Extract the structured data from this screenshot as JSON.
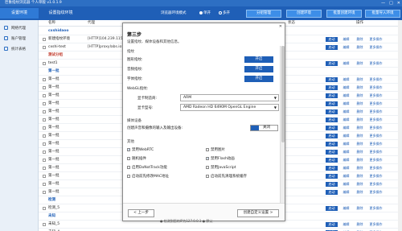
{
  "window": {
    "title": "巨象指纹浏览器 个人单版 v1.0.1.9",
    "controls": [
      "—",
      "□",
      "✕"
    ]
  },
  "topbar": {
    "tab_env": "设置环境",
    "tab_browser": "设置指纹环境",
    "mode_label": "浏览器环境模式",
    "radio_single": "单开",
    "radio_multi": "多开",
    "buttons": [
      "分组管理",
      "创建环境",
      "批量创建环境",
      "批量导入环境"
    ]
  },
  "sidebar": {
    "items": [
      {
        "label": "网络代理",
        "icon": "globe-icon"
      },
      {
        "label": "账户管理",
        "icon": "user-icon"
      },
      {
        "label": "统计表格",
        "icon": "chart-icon"
      }
    ]
  },
  "list": {
    "headers": {
      "name": "名称",
      "proxy": "代理",
      "status": "状态",
      "actions": "操作"
    },
    "rows": [
      {
        "type": "group",
        "name": "cxshidaoo",
        "red": false
      },
      {
        "type": "item",
        "name": "新建指纹环境",
        "proxy": "[HTTP]104.239.115..."
      },
      {
        "type": "item",
        "name": "cxshi-test",
        "proxy": "[HTTP]proxylabs.io:..."
      },
      {
        "type": "group",
        "name": "测试分组",
        "red": true
      },
      {
        "type": "item",
        "name": "test1",
        "proxy": ""
      },
      {
        "type": "group",
        "name": "第一批",
        "red": false
      },
      {
        "type": "item",
        "name": "第一批",
        "proxy": ""
      },
      {
        "type": "item",
        "name": "第一批",
        "proxy": ""
      },
      {
        "type": "item",
        "name": "第一批",
        "proxy": ""
      },
      {
        "type": "item",
        "name": "第一批",
        "proxy": ""
      },
      {
        "type": "item",
        "name": "第一批",
        "proxy": ""
      },
      {
        "type": "item",
        "name": "第一批",
        "proxy": ""
      },
      {
        "type": "item",
        "name": "第一批",
        "proxy": ""
      },
      {
        "type": "item",
        "name": "第一批",
        "proxy": ""
      },
      {
        "type": "item",
        "name": "第一批",
        "proxy": ""
      },
      {
        "type": "item",
        "name": "第一批",
        "proxy": ""
      },
      {
        "type": "item",
        "name": "第一批",
        "proxy": ""
      },
      {
        "type": "item",
        "name": "第一批",
        "proxy": ""
      },
      {
        "type": "item",
        "name": "第一批",
        "proxy": ""
      },
      {
        "type": "item",
        "name": "第一批",
        "proxy": ""
      },
      {
        "type": "item",
        "name": "第一批",
        "proxy": ""
      },
      {
        "type": "group",
        "name": "检测",
        "red": false
      },
      {
        "type": "item",
        "name": "检测_5",
        "proxy": ""
      },
      {
        "type": "group",
        "name": "未知",
        "red": false
      },
      {
        "type": "item",
        "name": "未知_5",
        "proxy": ""
      },
      {
        "type": "item",
        "name": "未知_4",
        "proxy": ""
      }
    ],
    "actions": {
      "start": "启动",
      "edit": "编辑",
      "delete": "删除",
      "more": "更多操作"
    }
  },
  "dialog": {
    "close": "✕",
    "title": "第三步",
    "desc": "设置指纹、媒体设备和其他信息。",
    "fingerprint_section": "指纹",
    "fingerprint_items": [
      {
        "label": "图形指纹:",
        "value": "开启"
      },
      {
        "label": "音频指纹:",
        "value": "开启"
      },
      {
        "label": "字体指纹:",
        "value": "开启"
      }
    ],
    "webgl_label": "WebGL指纹:",
    "gpu_vendor_label": "显卡制造商:",
    "gpu_vendor_value": "ARM",
    "gpu_model_label": "显卡型号:",
    "gpu_model_value": "AMD Radeon HD 6490M OpenGL Engine",
    "media_section": "媒体设备",
    "media_desc": "创建声音和摄像的输入及输出设备:",
    "media_toggle": "关闭",
    "other_section": "其他",
    "checkboxes": [
      {
        "label": "禁用WebRTC",
        "checked": true
      },
      {
        "label": "禁用图片",
        "checked": false
      },
      {
        "label": "随机插件",
        "checked": false
      },
      {
        "label": "禁用Flash动画",
        "checked": true
      },
      {
        "label": "启用DoNotTrack功能",
        "checked": false
      },
      {
        "label": "禁用JavaScript",
        "checked": false
      },
      {
        "label": "启动前先修改MAC地址",
        "checked": false
      },
      {
        "label": "启动前先清理系统缓存",
        "checked": false
      }
    ],
    "prev_button": "< 上一步",
    "next_button": "创建自定义设置 >"
  },
  "status_note": "● 检测到您的IP为127.0.0.1 ● 默认"
}
